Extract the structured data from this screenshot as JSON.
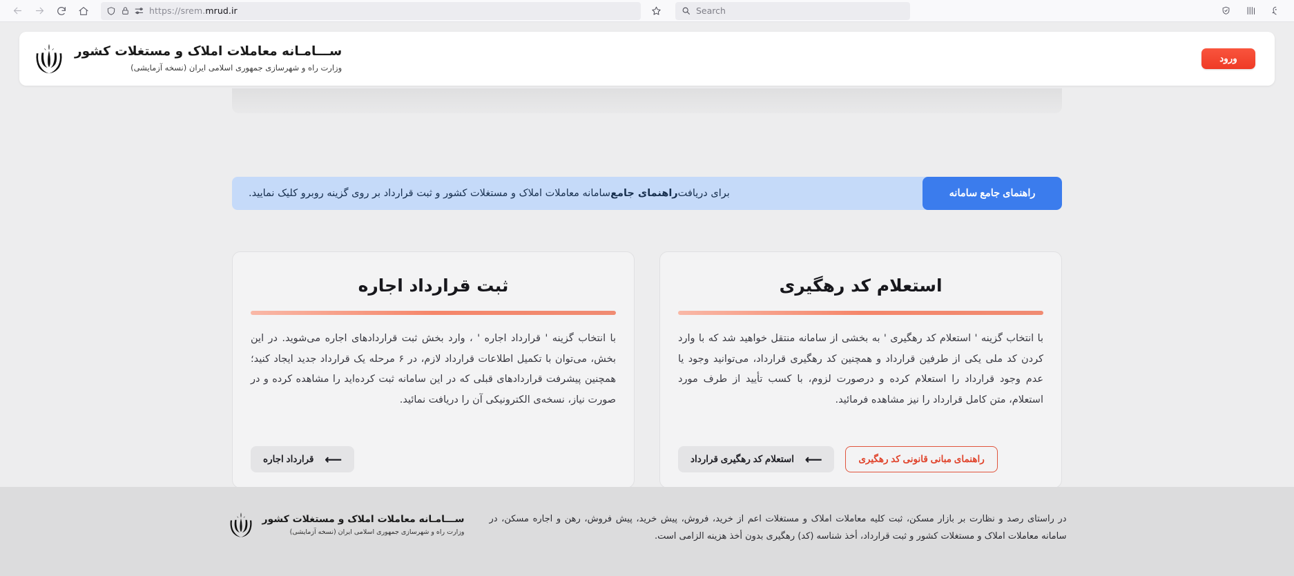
{
  "browser": {
    "back_icon": "arrow-left-icon",
    "forward_icon": "arrow-right-icon",
    "reload_icon": "reload-icon",
    "home_icon": "home-icon",
    "shield_icon": "shield-icon",
    "lock_icon": "padlock-icon",
    "permissions_icon": "page-actions-icon",
    "url_prefix": "https://srem.",
    "url_domain": "mrud.ir",
    "bookmark_icon": "star-icon",
    "search_icon": "search-icon",
    "search_placeholder": "Search",
    "tracking_icon": "shield-check-icon",
    "library_icon": "library-icon",
    "account_icon": "account-icon"
  },
  "header": {
    "title": "ســـامـانه معاملات املاک و مستغلات کشور",
    "subtitle": "وزارت راه و شهرسازی جمهوری اسلامی ایران (نسخه آزمایشی)",
    "emblem_icon": "iran-emblem-icon",
    "login_label": "ورود"
  },
  "banner": {
    "text_before": "برای دریافت ",
    "text_bold": "راهنمای جامع",
    "text_after": " سامانه معاملات املاک و مستغلات کشور و ثبت قرارداد بر روی گزینه روبرو کلیک نمایید.",
    "button_label": "راهنمای جامع سامانه",
    "button_color": "#3b7ced",
    "background_color": "#c5daf9"
  },
  "cards": [
    {
      "id": "register-lease-contract",
      "title": "ثبت قرارداد اجاره",
      "body": "با انتخاب گزینه ' قرارداد اجاره ' ، وارد بخش ثبت قراردادهای اجاره می‌شوید. در این بخش، می‌توان با تکمیل اطلاعات قرارداد لازم، در ۶ مرحله یک قرارداد جدید ایجاد کنید؛ همچنین پیشرفت قراردادهای قبلی که در این سامانه ثبت کرده‌اید را مشاهده کرده و در صورت نیاز، نسخه‌ی الکترونیکی آن را دریافت نمائید.",
      "primary_button": "قرارداد اجاره",
      "arrow_icon": "arrow-left-icon"
    },
    {
      "id": "tracking-code-inquiry",
      "title": "استعلام کد رهگیری",
      "body": "با انتخاب گزینه ' استعلام کد رهگیری ' به بخشی از سامانه منتقل خواهید شد که با وارد کردن کد ملی یکی از طرفین قرارداد و همچنین کد رهگیری قرارداد، می‌توانید وجود یا عدم وجود قرارداد را استعلام کرده و درصورت لزوم، با کسب تأیید از طرف مورد استعلام، متن کامل قرارداد را نیز مشاهده فرمائید.",
      "primary_button": "استعلام کد رهگیری قرارداد",
      "secondary_button": "راهنمای مبانی قانونی کد رهگیری",
      "arrow_icon": "arrow-left-icon",
      "secondary_color": "#e0442c"
    }
  ],
  "footer": {
    "emblem_icon": "iran-emblem-icon",
    "title": "ســـامـانه معاملات املاک و مستغلات کشور",
    "subtitle": "وزارت راه و شهرسازی جمهوری اسلامی ایران (نسخه آزمایشی)",
    "note": "در راستای رصد و نظارت بر بازار مسکن، ثبت کلیه معاملات املاک و مستغلات اعم از خرید، فروش، پیش خرید، پیش فروش، رهن و اجاره مسکن، در سامانه معاملات املاک و مستغلات کشور و ثبت قرارداد، أخذ شناسه (کد) رهگیری بدون أخذ هزینه الزامی است."
  }
}
